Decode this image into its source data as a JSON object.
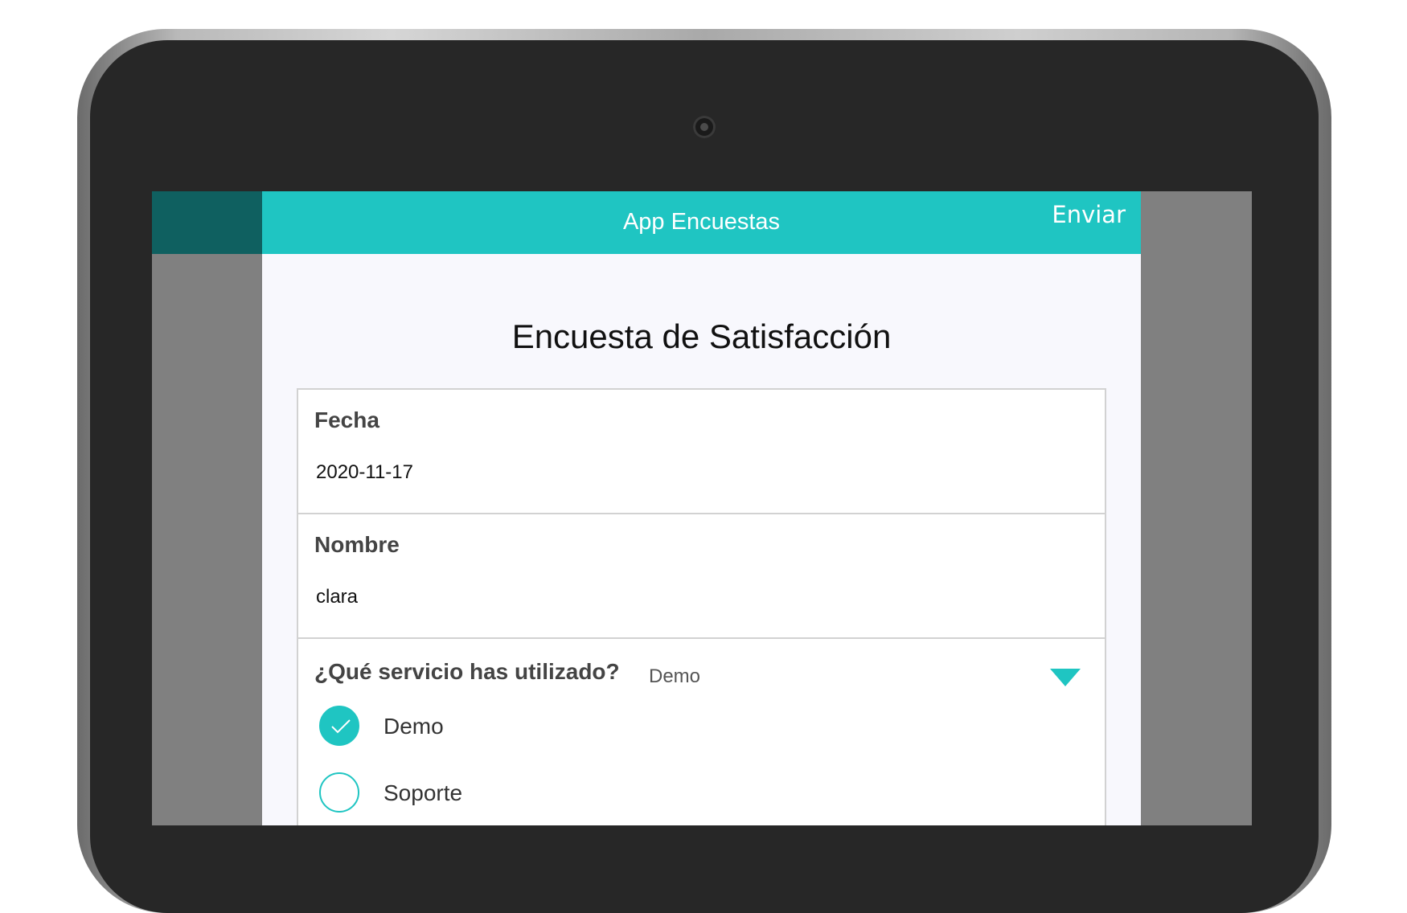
{
  "app": {
    "nav_title": "App Encuestas",
    "nav_action": "Enviar",
    "accent_color": "#1fc5c2"
  },
  "survey": {
    "title": "Encuesta de Satisfacción",
    "fields": {
      "fecha": {
        "label": "Fecha",
        "value": "2020-11-17"
      },
      "nombre": {
        "label": "Nombre",
        "value": "clara"
      }
    },
    "question": {
      "label": "¿Qué servicio has utilizado?",
      "selected": "Demo",
      "options": [
        {
          "label": "Demo",
          "checked": true
        },
        {
          "label": "Soporte",
          "checked": false
        }
      ]
    }
  },
  "icons": {
    "camera": "camera-icon",
    "dropdown": "chevron-down-icon",
    "check": "check-icon"
  }
}
